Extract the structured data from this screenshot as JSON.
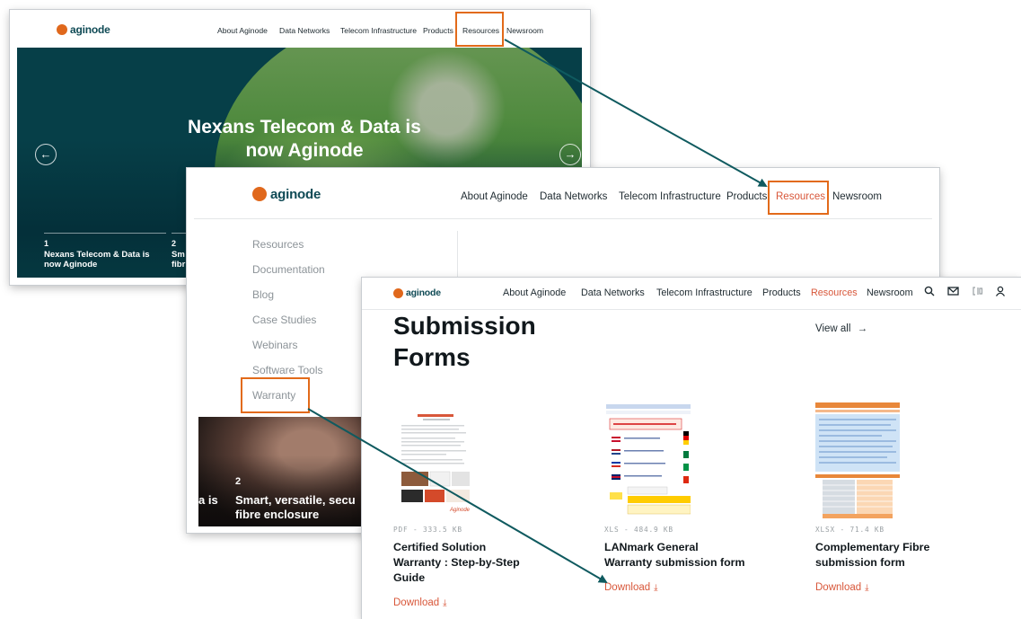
{
  "brand": {
    "logo_text": "aginode",
    "accent": "#d8573a",
    "logo_color": "#e0681c",
    "teal": "#0f4a55",
    "highlight": "#e26a1a",
    "arrow": "#0f5a5f"
  },
  "nav": {
    "items": [
      "About Aginode",
      "Data Networks",
      "Telecom Infrastructure",
      "Products",
      "Resources",
      "Newsroom"
    ],
    "active": "Resources",
    "icons": [
      "search-icon",
      "mail-icon",
      "compare-icon",
      "user-icon"
    ]
  },
  "hero": {
    "title_line1": "Nexans Telecom & Data is",
    "title_line2": "now Aginode",
    "prev_icon": "arrow-left-icon",
    "next_icon": "arrow-right-icon",
    "slides": [
      {
        "num": "1",
        "caption_line1": "Nexans Telecom & Data is",
        "caption_line2": "now Aginode"
      },
      {
        "num": "2",
        "caption_line1": "Sm",
        "caption_line2": "fibr"
      }
    ]
  },
  "resources_menu": {
    "items": [
      "Resources",
      "Documentation",
      "Blog",
      "Case Studies",
      "Webinars",
      "Software Tools",
      "Warranty"
    ],
    "card": {
      "num": "2",
      "caption_prefix": "a is",
      "caption_line1": "Smart, versatile, secu",
      "caption_line2": "fibre enclosure"
    }
  },
  "submission": {
    "title_line1": "Submission",
    "title_line2": "Forms",
    "view_all": "View all",
    "view_all_icon": "arrow-right-icon",
    "download_icon": "download-icon",
    "documents": [
      {
        "meta": "PDF - 333.5 KB",
        "title_lines": [
          "Certified Solution",
          "Warranty : Step-by-Step",
          "Guide"
        ],
        "download": "Download"
      },
      {
        "meta": "XLS - 484.9 KB",
        "title_lines": [
          "LANmark General",
          "Warranty submission form"
        ],
        "download": "Download"
      },
      {
        "meta": "XLSX - 71.4 KB",
        "title_lines": [
          "Complementary Fibre",
          "submission form"
        ],
        "download": "Download"
      }
    ]
  }
}
